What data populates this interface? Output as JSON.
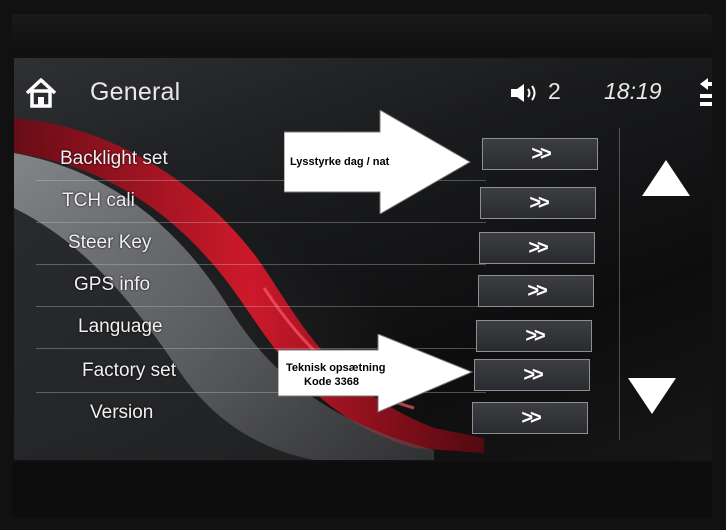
{
  "header": {
    "title": "General",
    "volume_level": "2",
    "time": "18:19"
  },
  "menu": {
    "items": [
      {
        "label": "Backlight set",
        "button": ">>"
      },
      {
        "label": "TCH cali",
        "button": ">>"
      },
      {
        "label": "Steer Key",
        "button": ">>"
      },
      {
        "label": "GPS info",
        "button": ">>"
      },
      {
        "label": "Language",
        "button": ">>"
      },
      {
        "label": "Factory set",
        "button": ">>"
      },
      {
        "label": "Version",
        "button": ">>"
      }
    ]
  },
  "annotations": {
    "backlight_note": "Lysstyrke dag / nat",
    "factory_note_line1": "Teknisk opsætning",
    "factory_note_line2": "Kode 3368"
  },
  "colors": {
    "accent_red": "#d8162a",
    "text": "#f0f0f0",
    "button_bg": "#333438"
  },
  "icons": [
    "home-icon",
    "speaker-icon",
    "back-icon",
    "scroll-up-icon",
    "scroll-down-icon"
  ]
}
